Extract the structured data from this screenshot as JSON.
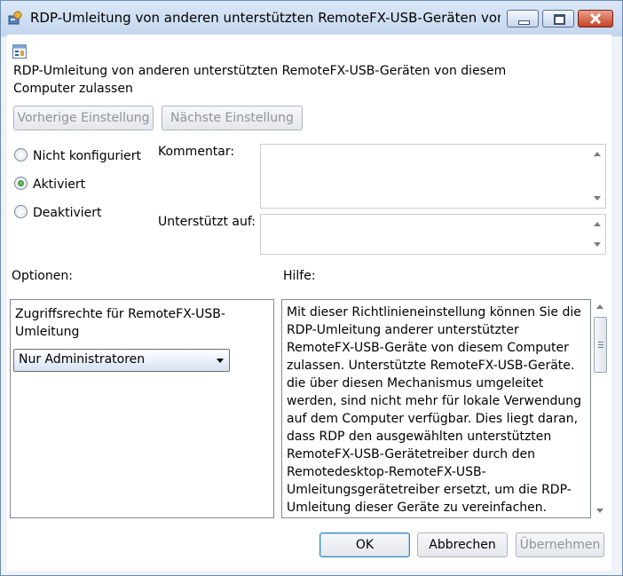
{
  "window": {
    "title": "RDP-Umleitung von anderen unterstützten RemoteFX-USB-Geräten von diesem..."
  },
  "policy": {
    "heading": "RDP-Umleitung von anderen unterstützten RemoteFX-USB-Geräten von diesem Computer zulassen"
  },
  "nav": {
    "prev_label": "Vorherige Einstellung",
    "next_label": "Nächste Einstellung"
  },
  "state": {
    "options": [
      {
        "label": "Nicht konfiguriert",
        "checked": false
      },
      {
        "label": "Aktiviert",
        "checked": true
      },
      {
        "label": "Deaktiviert",
        "checked": false
      }
    ]
  },
  "comment": {
    "label": "Kommentar:",
    "value": ""
  },
  "supported": {
    "label": "Unterstützt auf:",
    "value": ""
  },
  "options_panel": {
    "header": "Optionen:",
    "field_label": "Zugriffsrechte für RemoteFX-USB-Umleitung",
    "selected": "Nur Administratoren"
  },
  "help_panel": {
    "header": "Hilfe:",
    "text": "Mit dieser Richtlinieneinstellung können Sie die RDP-Umleitung anderer unterstützter RemoteFX-USB-Geräte von diesem Computer zulassen. Unterstützte RemoteFX-USB-Geräte. die über diesen Mechanismus umgeleitet werden, sind nicht mehr für lokale Verwendung auf dem Computer verfügbar. Dies liegt daran, dass RDP den ausgewählten unterstützten RemoteFX-USB-Gerätetreiber durch den Remotedesktop-RemoteFX-USB-Umleitungsgerätetreiber ersetzt, um die RDP-Umleitung dieser Geräte zu vereinfachen."
  },
  "footer": {
    "ok_label": "OK",
    "cancel_label": "Abbrechen",
    "apply_label": "Übernehmen"
  },
  "icons": {
    "app": "group-policy-icon",
    "policy": "policy-setting-icon",
    "minimize": "minimize-icon",
    "maximize": "maximize-icon",
    "close": "close-icon"
  },
  "colors": {
    "titlebar": "#c9daf0",
    "close_button": "#c44224",
    "checked_radio": "#2f8a26"
  }
}
